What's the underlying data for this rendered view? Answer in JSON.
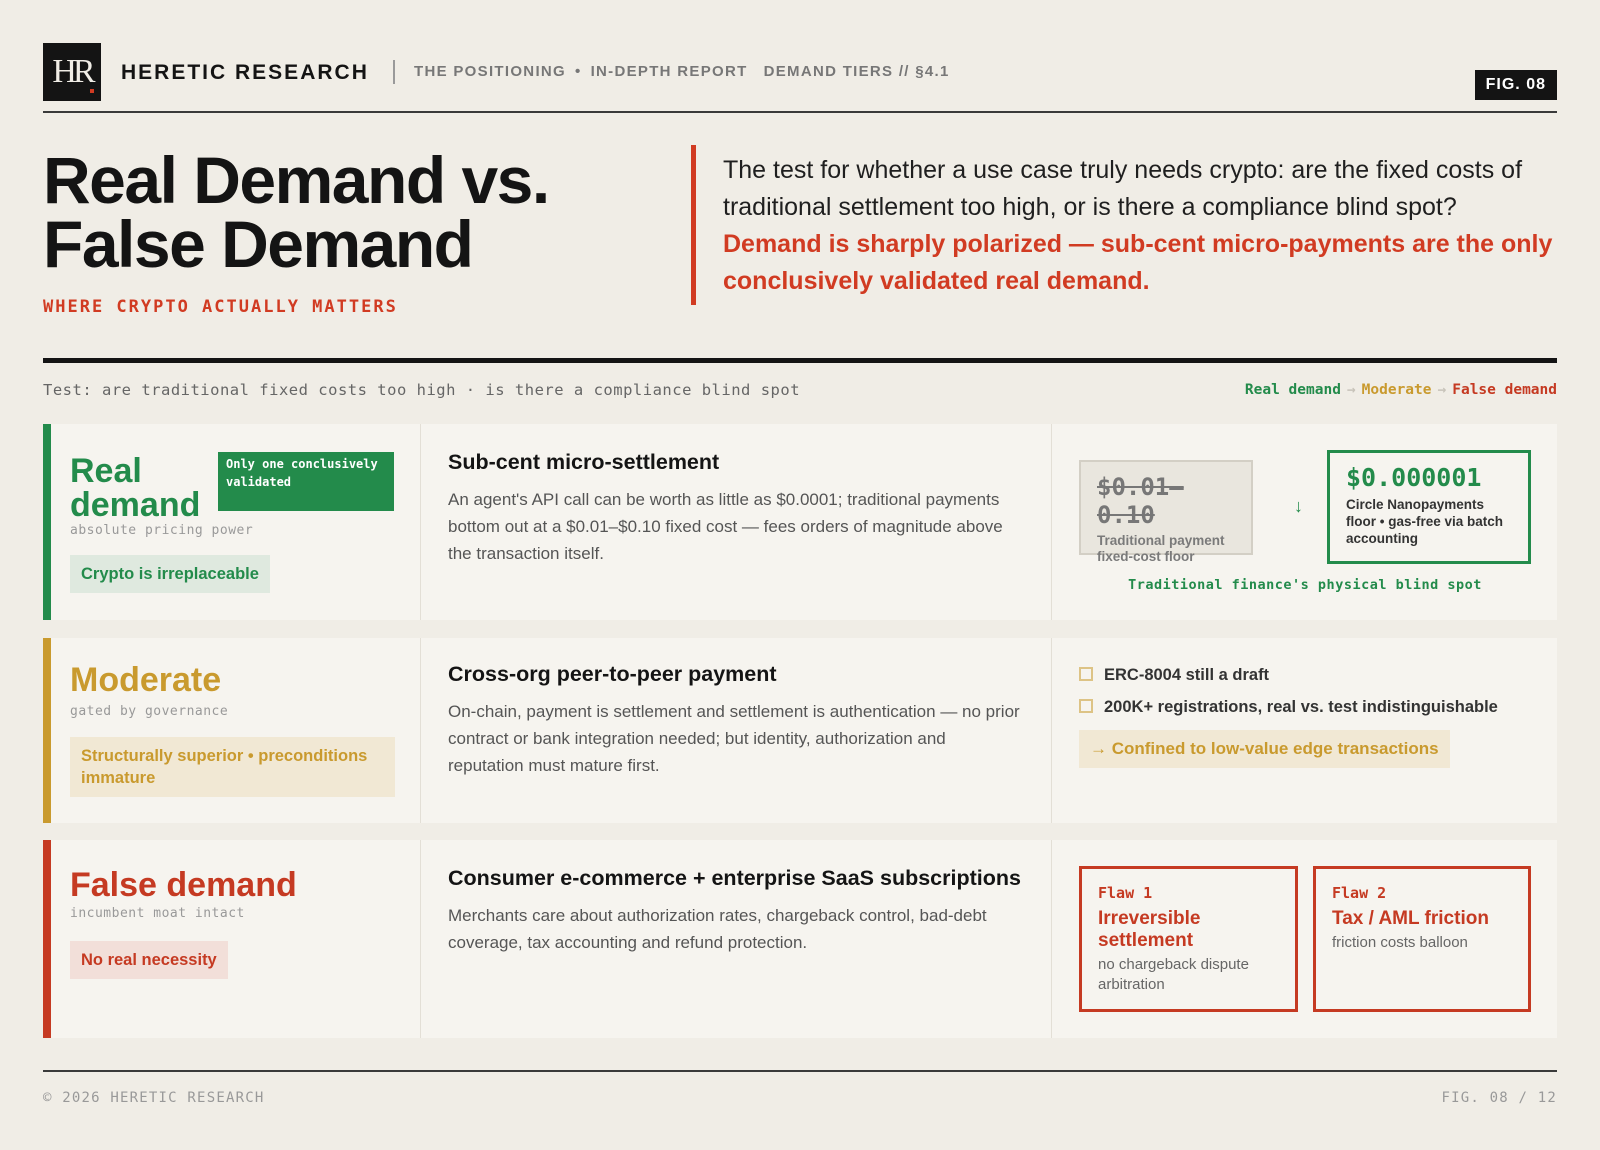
{
  "header": {
    "logo": "HR",
    "brand": "HERETIC RESEARCH",
    "section": "THE POSITIONING",
    "bullet": "•",
    "report": "IN-DEPTH REPORT",
    "tier_ref": "DEMAND TIERS // §4.1",
    "fig": "FIG. 08"
  },
  "title": {
    "line1": "Real Demand vs.",
    "line2": "False Demand",
    "subtitle": "WHERE CRYPTO ACTUALLY MATTERS"
  },
  "quote": {
    "plain": "The test for whether a use case truly needs crypto: are the fixed costs of traditional settlement too high, or is there a compliance blind spot?",
    "emphasis": "Demand is sharply polarized — sub-cent micro-payments are the only conclusively validated real demand."
  },
  "testline": "Test: are traditional fixed costs too high · is there a compliance blind spot",
  "legend": {
    "real": "Real demand",
    "moderate": "Moderate",
    "false": "False demand",
    "arrow": "→"
  },
  "colors": {
    "real": "#238b4b",
    "moderate": "#c99a2e",
    "false": "#c53a22",
    "accent": "#d13b22"
  },
  "rows": {
    "real": {
      "name": "Real demand",
      "sub": "absolute pricing power",
      "chip": "Crypto is irreplaceable",
      "badge": "Only one conclusively validated",
      "title": "Sub-cent micro-settlement",
      "text": "An agent's API call can be worth as little as $0.0001; traditional payments bottom out at a $0.01–$0.10 fixed cost — fees orders of magnitude above the transaction itself.",
      "old_price": "$0.01–0.10",
      "old_label": "Traditional payment fixed-cost floor",
      "arrow": "↓",
      "new_price": "$0.000001",
      "new_label": "Circle Nanopayments floor • gas-free via batch accounting",
      "blindspot": "Traditional finance's physical blind spot"
    },
    "moderate": {
      "name": "Moderate",
      "sub": "gated by governance",
      "chip": "Structurally superior • preconditions immature",
      "title": "Cross-org peer-to-peer payment",
      "text": "On-chain, payment is settlement and settlement is authentication — no prior contract or bank integration needed; but identity, authorization and reputation must mature first.",
      "check1": "ERC-8004 still a draft",
      "check2": "200K+ registrations, real vs. test indistinguishable",
      "confined": "→ Confined to low-value edge transactions"
    },
    "false": {
      "name": "False demand",
      "sub": "incumbent moat intact",
      "chip": "No real necessity",
      "title": "Consumer e-commerce + enterprise SaaS subscriptions",
      "text": "Merchants care about authorization rates, chargeback control, bad-debt coverage, tax accounting and refund protection.",
      "flaw1_num": "Flaw 1",
      "flaw1_head": "Irreversible settlement",
      "flaw1_desc": "no chargeback dispute arbitration",
      "flaw2_num": "Flaw 2",
      "flaw2_head": "Tax / AML friction",
      "flaw2_desc": "friction costs balloon"
    }
  },
  "footer": {
    "left": "© 2026 HERETIC RESEARCH",
    "right": "FIG. 08 / 12"
  }
}
